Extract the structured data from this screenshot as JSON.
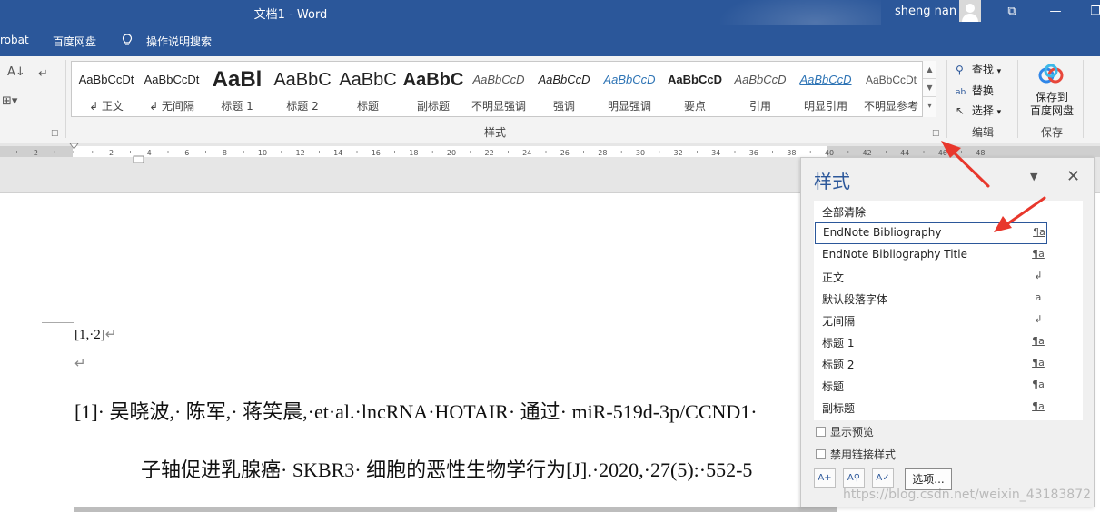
{
  "window": {
    "title": "文档1  -  Word",
    "user": "sheng nan"
  },
  "tabs": {
    "acrobat": "robat",
    "baidu": "百度网盘",
    "tellme": "操作说明搜索"
  },
  "ribbon": {
    "styles_group_label": "样式",
    "edit_group_label": "编辑",
    "save_group_label": "保存",
    "styles": [
      {
        "sample": "AaBbCcDt",
        "name": "↲ 正文"
      },
      {
        "sample": "AaBbCcDt",
        "name": "↲ 无间隔"
      },
      {
        "sample": "AaBl",
        "name": "标题 1"
      },
      {
        "sample": "AaBbC",
        "name": "标题 2"
      },
      {
        "sample": "AaBbC",
        "name": "标题"
      },
      {
        "sample": "AaBbC",
        "name": "副标题"
      },
      {
        "sample": "AaBbCcD",
        "name": "不明显强调"
      },
      {
        "sample": "AaBbCcD",
        "name": "强调"
      },
      {
        "sample": "AaBbCcD",
        "name": "明显强调"
      },
      {
        "sample": "AaBbCcD",
        "name": "要点"
      },
      {
        "sample": "AaBbCcD",
        "name": "引用"
      },
      {
        "sample": "AaBbCcD",
        "name": "明显引用"
      },
      {
        "sample": "AaBbCcDt",
        "name": "不明显参考"
      }
    ],
    "find": "查找",
    "replace": "替换",
    "select": "选择",
    "save_baidu_line1": "保存到",
    "save_baidu_line2": "百度网盘"
  },
  "document": {
    "line1": "[1,·2]",
    "ref_line1": "[1]· 吴晓波,· 陈军,· 蒋笑晨,·et·al.·lncRNA·HOTAIR· 通过· miR-519d-3p/CCND1·",
    "ref_line2": "子轴促进乳腺癌· SKBR3· 细胞的恶性生物学行为[J].·2020,·27(5):·552-5"
  },
  "styles_pane": {
    "title": "样式",
    "items": [
      {
        "name": "全部清除",
        "mark": ""
      },
      {
        "name": "EndNote Bibliography",
        "mark": "¶a"
      },
      {
        "name": "EndNote Bibliography Title",
        "mark": "¶a"
      },
      {
        "name": "正文",
        "mark": "↲"
      },
      {
        "name": "默认段落字体",
        "mark": "a"
      },
      {
        "name": "无间隔",
        "mark": "↲"
      },
      {
        "name": "标题 1",
        "mark": "¶a"
      },
      {
        "name": "标题 2",
        "mark": "¶a"
      },
      {
        "name": "标题",
        "mark": "¶a"
      },
      {
        "name": "副标题",
        "mark": "¶a"
      }
    ],
    "show_preview": "显示预览",
    "disable_linked": "禁用链接样式",
    "options": "选项..."
  },
  "watermark": "https://blog.csdn.net/weixin_43183872",
  "colors": {
    "accent": "#2b579a",
    "arrow": "#e8372c"
  }
}
